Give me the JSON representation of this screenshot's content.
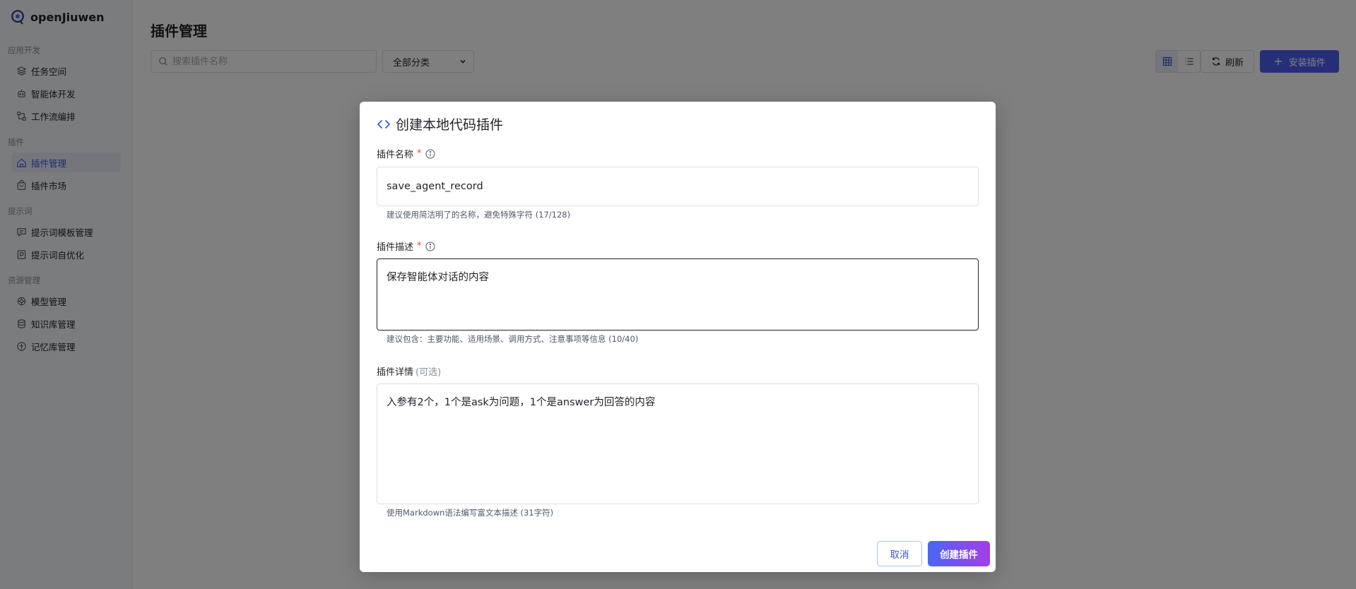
{
  "app": {
    "name": "openJiuwen"
  },
  "sidebar": {
    "groups": [
      {
        "title": "应用开发",
        "items": [
          {
            "label": "任务空间",
            "icon": "layers-icon"
          },
          {
            "label": "智能体开发",
            "icon": "robot-icon"
          },
          {
            "label": "工作流编排",
            "icon": "workflow-icon"
          }
        ]
      },
      {
        "title": "插件",
        "items": [
          {
            "label": "插件管理",
            "icon": "plugin-icon",
            "active": true
          },
          {
            "label": "插件市场",
            "icon": "store-icon"
          }
        ]
      },
      {
        "title": "提示词",
        "items": [
          {
            "label": "提示词模板管理",
            "icon": "chat-template-icon"
          },
          {
            "label": "提示词自优化",
            "icon": "prompt-optimize-icon"
          }
        ]
      },
      {
        "title": "资源管理",
        "items": [
          {
            "label": "模型管理",
            "icon": "model-icon"
          },
          {
            "label": "知识库管理",
            "icon": "database-icon"
          },
          {
            "label": "记忆库管理",
            "icon": "memory-icon"
          }
        ]
      }
    ]
  },
  "main": {
    "title": "插件管理",
    "search": {
      "placeholder": "搜索插件名称"
    },
    "category": {
      "selected": "全部分类"
    },
    "refresh_label": "刷新",
    "install_label": "安装插件"
  },
  "modal": {
    "title": "创建本地代码插件",
    "name_field": {
      "label": "插件名称",
      "required_mark": "*",
      "value": "save_agent_record",
      "hint": "建议使用简洁明了的名称，避免特殊字符 (17/128)"
    },
    "desc_field": {
      "label": "插件描述",
      "required_mark": "*",
      "value": "保存智能体对话的内容",
      "hint": "建议包含：主要功能、适用场景、调用方式、注意事项等信息 (10/40)"
    },
    "detail_field": {
      "label": "插件详情",
      "optional_mark": "(可选)",
      "value": "入参有2个，1个是ask为问题，1个是answer为回答的内容",
      "hint": "使用Markdown语法编写富文本描述 (31字符)"
    },
    "cancel_label": "取消",
    "create_label": "创建插件"
  },
  "colors": {
    "accent": "#3a5bd9",
    "primary_button": "#4a5ef0",
    "required": "#f53f3f"
  }
}
